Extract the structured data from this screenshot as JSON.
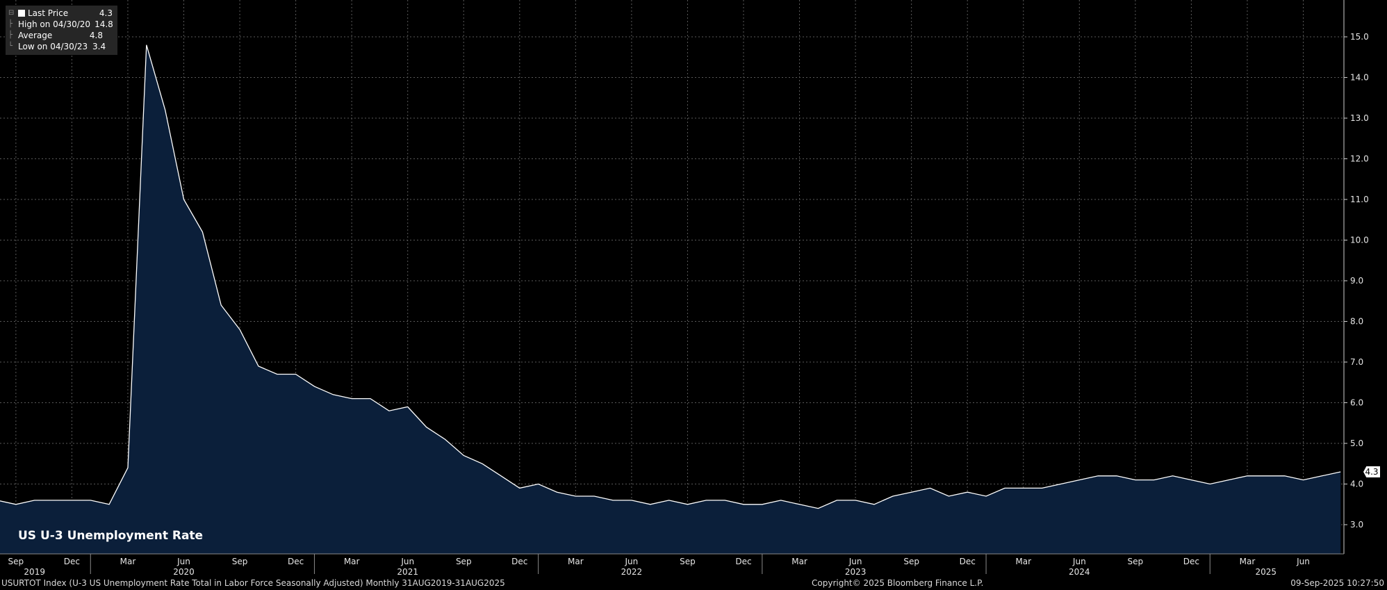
{
  "legend": {
    "last_label": "Last Price",
    "last_value": "4.3",
    "high_label": "High on 04/30/20",
    "high_value": "14.8",
    "avg_label": "Average",
    "avg_value": "4.8",
    "low_label": "Low on 04/30/23",
    "low_value": "3.4"
  },
  "title": "US U-3 Unemployment Rate",
  "last_value_box": "4.3",
  "footer": {
    "left": "USURTOT Index (U-3 US Unemployment Rate Total in Labor Force Seasonally Adjusted)  Monthly 31AUG2019-31AUG2025",
    "center": "Copyright© 2025 Bloomberg Finance L.P.",
    "right": "09-Sep-2025 10:27:50"
  },
  "colors": {
    "line": "#ffffff",
    "fill": "#0b1f3a",
    "grid": "#5a5a5a",
    "background": "#000000"
  },
  "chart_data": {
    "type": "area",
    "series": [
      {
        "x": [
          "2019-08",
          "2019-09",
          "2019-10",
          "2019-11",
          "2019-12",
          "2020-01",
          "2020-02",
          "2020-03",
          "2020-04",
          "2020-05",
          "2020-06",
          "2020-07",
          "2020-08",
          "2020-09",
          "2020-10",
          "2020-11",
          "2020-12",
          "2021-01",
          "2021-02",
          "2021-03",
          "2021-04",
          "2021-05",
          "2021-06",
          "2021-07",
          "2021-08",
          "2021-09",
          "2021-10",
          "2021-11",
          "2021-12",
          "2022-01",
          "2022-02",
          "2022-03",
          "2022-04",
          "2022-05",
          "2022-06",
          "2022-07",
          "2022-08",
          "2022-09",
          "2022-10",
          "2022-11",
          "2022-12",
          "2023-01",
          "2023-02",
          "2023-03",
          "2023-04",
          "2023-05",
          "2023-06",
          "2023-07",
          "2023-08",
          "2023-09",
          "2023-10",
          "2023-11",
          "2023-12",
          "2024-01",
          "2024-02",
          "2024-03",
          "2024-04",
          "2024-05",
          "2024-06",
          "2024-07",
          "2024-08",
          "2024-09",
          "2024-10",
          "2024-11",
          "2024-12",
          "2025-01",
          "2025-02",
          "2025-03",
          "2025-04",
          "2025-05",
          "2025-06",
          "2025-07",
          "2025-08"
        ],
        "values": [
          3.6,
          3.5,
          3.6,
          3.6,
          3.6,
          3.6,
          3.5,
          4.4,
          14.8,
          13.2,
          11.0,
          10.2,
          8.4,
          7.8,
          6.9,
          6.7,
          6.7,
          6.4,
          6.2,
          6.1,
          6.1,
          5.8,
          5.9,
          5.4,
          5.1,
          4.7,
          4.5,
          4.2,
          3.9,
          4.0,
          3.8,
          3.7,
          3.7,
          3.6,
          3.6,
          3.5,
          3.6,
          3.5,
          3.6,
          3.6,
          3.5,
          3.5,
          3.6,
          3.5,
          3.4,
          3.6,
          3.6,
          3.5,
          3.7,
          3.8,
          3.9,
          3.7,
          3.8,
          3.7,
          3.9,
          3.9,
          3.9,
          4.0,
          4.1,
          4.2,
          4.2,
          4.1,
          4.1,
          4.2,
          4.1,
          4.0,
          4.1,
          4.2,
          4.2,
          4.2,
          4.1,
          4.2,
          4.3
        ]
      }
    ],
    "ylim": [
      2.3,
      15.3
    ],
    "y_ticks": [
      "3.0",
      "4.0",
      "5.0",
      "6.0",
      "7.0",
      "8.0",
      "9.0",
      "10.0",
      "11.0",
      "12.0",
      "13.0",
      "14.0",
      "15.0"
    ],
    "x_month_ticks": [
      {
        "label": "Sep",
        "x": "2019-09"
      },
      {
        "label": "Dec",
        "x": "2019-12"
      },
      {
        "label": "Mar",
        "x": "2020-03"
      },
      {
        "label": "Jun",
        "x": "2020-06"
      },
      {
        "label": "Sep",
        "x": "2020-09"
      },
      {
        "label": "Dec",
        "x": "2020-12"
      },
      {
        "label": "Mar",
        "x": "2021-03"
      },
      {
        "label": "Jun",
        "x": "2021-06"
      },
      {
        "label": "Sep",
        "x": "2021-09"
      },
      {
        "label": "Dec",
        "x": "2021-12"
      },
      {
        "label": "Mar",
        "x": "2022-03"
      },
      {
        "label": "Jun",
        "x": "2022-06"
      },
      {
        "label": "Sep",
        "x": "2022-09"
      },
      {
        "label": "Dec",
        "x": "2022-12"
      },
      {
        "label": "Mar",
        "x": "2023-03"
      },
      {
        "label": "Jun",
        "x": "2023-06"
      },
      {
        "label": "Sep",
        "x": "2023-09"
      },
      {
        "label": "Dec",
        "x": "2023-12"
      },
      {
        "label": "Mar",
        "x": "2024-03"
      },
      {
        "label": "Jun",
        "x": "2024-06"
      },
      {
        "label": "Sep",
        "x": "2024-09"
      },
      {
        "label": "Dec",
        "x": "2024-12"
      },
      {
        "label": "Mar",
        "x": "2025-03"
      },
      {
        "label": "Jun",
        "x": "2025-06"
      }
    ],
    "x_year_labels": [
      {
        "label": "2019",
        "x": "2019-10"
      },
      {
        "label": "2020",
        "x": "2020-06"
      },
      {
        "label": "2021",
        "x": "2021-06"
      },
      {
        "label": "2022",
        "x": "2022-06"
      },
      {
        "label": "2023",
        "x": "2023-06"
      },
      {
        "label": "2024",
        "x": "2024-06"
      },
      {
        "label": "2025",
        "x": "2025-04"
      }
    ],
    "grid": true,
    "legend_position": "top-left"
  }
}
